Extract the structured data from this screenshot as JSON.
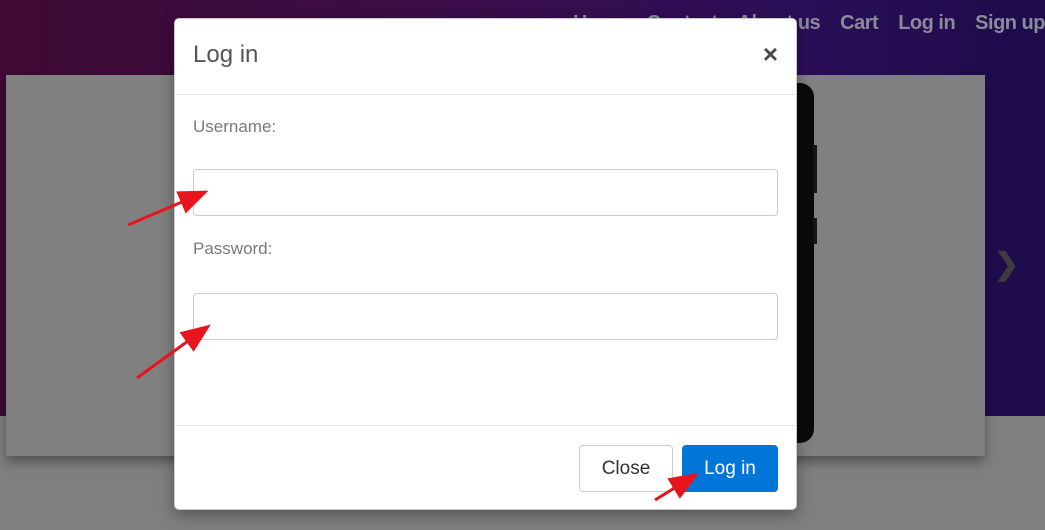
{
  "nav": {
    "items": [
      "Home",
      "Contact",
      "About us",
      "Cart",
      "Log in",
      "Sign up"
    ]
  },
  "carousel": {
    "next_icon": "chevron-right-icon"
  },
  "modal": {
    "title": "Log in",
    "close_icon": "close-icon",
    "close_glyph": "×",
    "username_label": "Username:",
    "username_value": "",
    "password_label": "Password:",
    "password_value": "",
    "close_button": "Close",
    "login_button": "Log in"
  },
  "colors": {
    "primary": "#0275d8",
    "annotation_arrow": "#e8141e",
    "hero_gradient_start": "#3f0a33",
    "hero_gradient_end": "#1d0b4a",
    "overlay": "#808080"
  }
}
